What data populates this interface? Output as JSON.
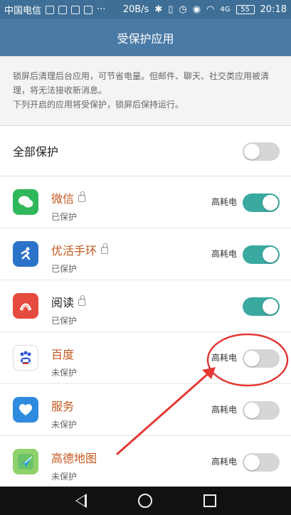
{
  "status_bar": {
    "carrier": "中国电信",
    "speed": "20B/s",
    "signal_label": "4G",
    "battery": "55",
    "time": "20:18"
  },
  "title": "受保护应用",
  "notice": {
    "line1": "锁屏后清理后台应用，可节省电量。但邮件、聊天、社交类应用被清理，将无法接收新消息。",
    "line2": "下列开启的应用将受保护，锁屏后保持运行。"
  },
  "all_protect": {
    "label": "全部保护",
    "enabled": false
  },
  "apps": [
    {
      "name": "微信",
      "locked": true,
      "status": "已保护",
      "power": "高耗电",
      "enabled": true,
      "icon": "wechat-icon",
      "color": "#2fb75b"
    },
    {
      "name": "优活手环",
      "locked": true,
      "status": "已保护",
      "power": "高耗电",
      "enabled": true,
      "icon": "runner-icon",
      "color": "#2b73c9"
    },
    {
      "name": "阅读",
      "locked": true,
      "status": "已保护",
      "power": "",
      "enabled": true,
      "icon": "reader-icon",
      "color": "#e44b3e"
    },
    {
      "name": "百度",
      "locked": false,
      "status": "未保护",
      "power": "高耗电",
      "enabled": false,
      "icon": "baidu-icon",
      "color": "#2f57d6"
    },
    {
      "name": "服务",
      "locked": false,
      "status": "未保护",
      "power": "高耗电",
      "enabled": false,
      "icon": "heart-icon",
      "color": "#2f8be0"
    },
    {
      "name": "高德地图",
      "locked": false,
      "status": "未保护",
      "power": "高耗电",
      "enabled": false,
      "icon": "map-icon",
      "color": "#1f9bf0"
    }
  ],
  "colors": {
    "header": "#4a7aa6",
    "accent_toggle_on": "#3aa99f",
    "app_name": "#c4581f",
    "annotation": "#e53935"
  }
}
